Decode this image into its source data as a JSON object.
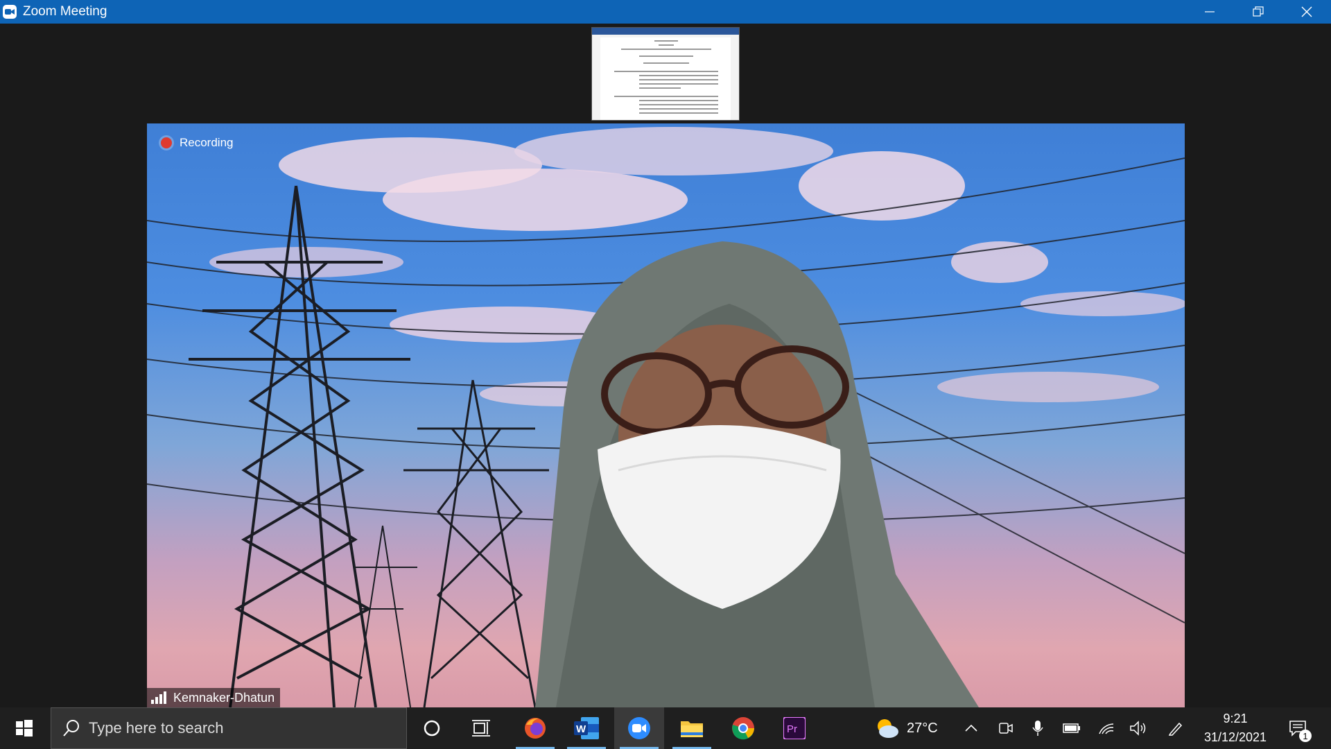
{
  "window": {
    "title": "Zoom Meeting"
  },
  "meeting": {
    "recording_label": "Recording",
    "participant_name": "Kemnaker-Dhatun"
  },
  "taskbar": {
    "search_placeholder": "Type here to search",
    "apps": [
      "cortana-icon",
      "task-view-icon",
      "firefox-icon",
      "word-icon",
      "zoom-icon",
      "file-explorer-icon",
      "chrome-icon",
      "premiere-pro-icon"
    ],
    "weather_temp": "27°C",
    "time": "9:21",
    "date": "31/12/2021",
    "notification_count": "1"
  },
  "colors": {
    "titlebar": "#0e64b6",
    "taskbar": "#1f1f1f",
    "recording_dot": "#e03a2f"
  }
}
